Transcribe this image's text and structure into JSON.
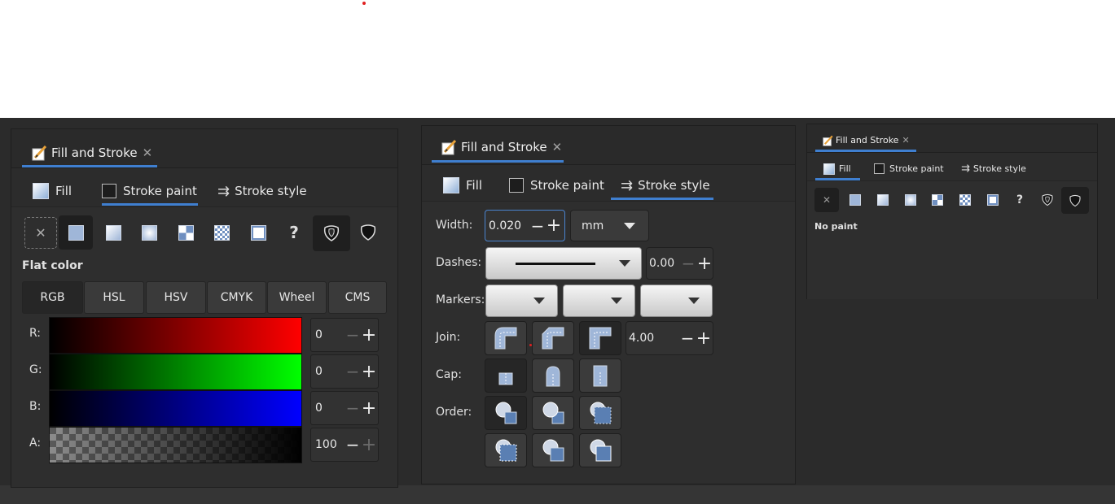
{
  "panels": [
    {
      "title": "Fill and Stroke",
      "close": "✕",
      "tabs": {
        "fill": "Fill",
        "stroke_paint": "Stroke paint",
        "stroke_style": "Stroke style",
        "active": "stroke_paint"
      },
      "section_title": "Flat color",
      "modes": [
        "RGB",
        "HSL",
        "HSV",
        "CMYK",
        "Wheel",
        "CMS"
      ],
      "active_mode": "RGB",
      "channels": [
        {
          "label": "R:",
          "value": "0"
        },
        {
          "label": "G:",
          "value": "0"
        },
        {
          "label": "B:",
          "value": "0"
        },
        {
          "label": "A:",
          "value": "100"
        }
      ]
    },
    {
      "title": "Fill and Stroke",
      "close": "✕",
      "tabs": {
        "fill": "Fill",
        "stroke_paint": "Stroke paint",
        "stroke_style": "Stroke style",
        "active": "stroke_style"
      },
      "width_label": "Width:",
      "width_value": "0.020",
      "unit": "mm",
      "dashes_label": "Dashes:",
      "dash_offset": "0.00",
      "markers_label": "Markers:",
      "join_label": "Join:",
      "miter_limit": "4.00",
      "cap_label": "Cap:",
      "order_label": "Order:"
    },
    {
      "title": "Fill and Stroke",
      "close": "✕",
      "tabs": {
        "fill": "Fill",
        "stroke_paint": "Stroke paint",
        "stroke_style": "Stroke style",
        "active": "fill"
      },
      "status": "No paint"
    }
  ],
  "icons": {
    "qmark": "?",
    "minus": "−",
    "plus": "+",
    "nopaint": "✕",
    "style": "⇉"
  },
  "colors": {
    "accent": "#3f7fd0",
    "panel_bg": "#2e2e2e",
    "swatch": "#9fb6d8"
  }
}
